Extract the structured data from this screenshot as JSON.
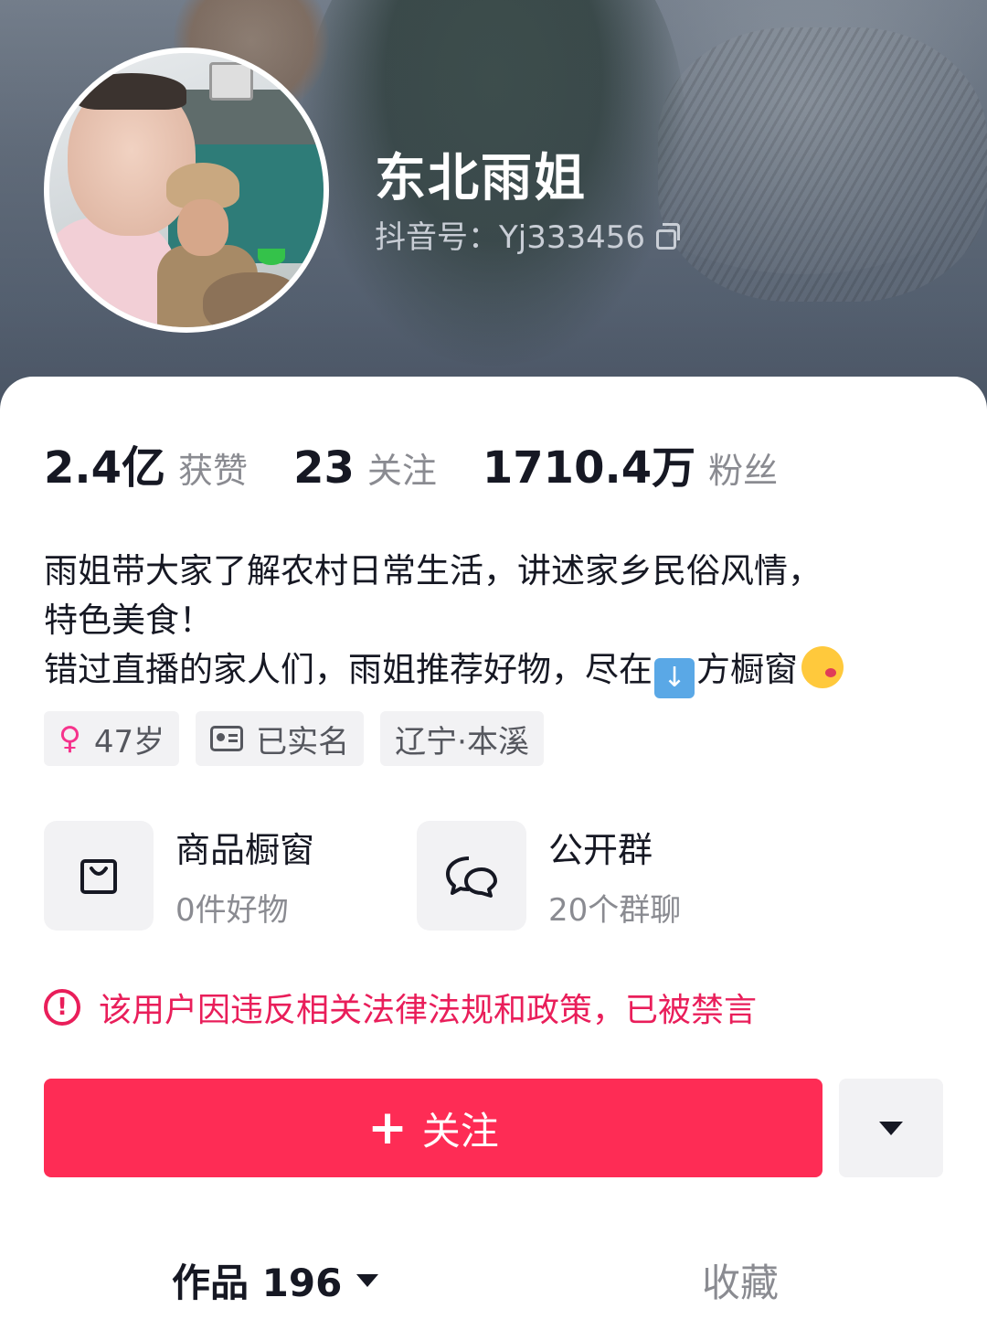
{
  "profile": {
    "nickname": "东北雨姐",
    "douyin_id": "抖音号：Yj333456"
  },
  "stats": [
    {
      "value": "2.4亿",
      "label": "获赞"
    },
    {
      "value": "23",
      "label": "关注"
    },
    {
      "value": "1710.4万",
      "label": "粉丝"
    }
  ],
  "bio": {
    "line1": "雨姐带大家了解农村日常生活，讲述家乡民俗风情，",
    "line2": "特色美食！",
    "line3_part1": "错过直播的家人们，雨姐推荐好物，尽在",
    "line3_part2": "方橱窗"
  },
  "tags": {
    "age": "47岁",
    "verified": "已实名",
    "location": "辽宁·本溪"
  },
  "services": [
    {
      "title": "商品橱窗",
      "subtitle": "0件好物",
      "icon": "shopping-bag-icon"
    },
    {
      "title": "公开群",
      "subtitle": "20个群聊",
      "icon": "chat-bubbles-icon"
    }
  ],
  "warning": "该用户因违反相关法律法规和政策，已被禁言",
  "actions": {
    "follow_label": "关注"
  },
  "tabs": {
    "works": "作品 196",
    "favorites": "收藏"
  },
  "colors": {
    "accent": "#fe2c55",
    "warning": "#e91e5a",
    "female": "#f6338c"
  }
}
